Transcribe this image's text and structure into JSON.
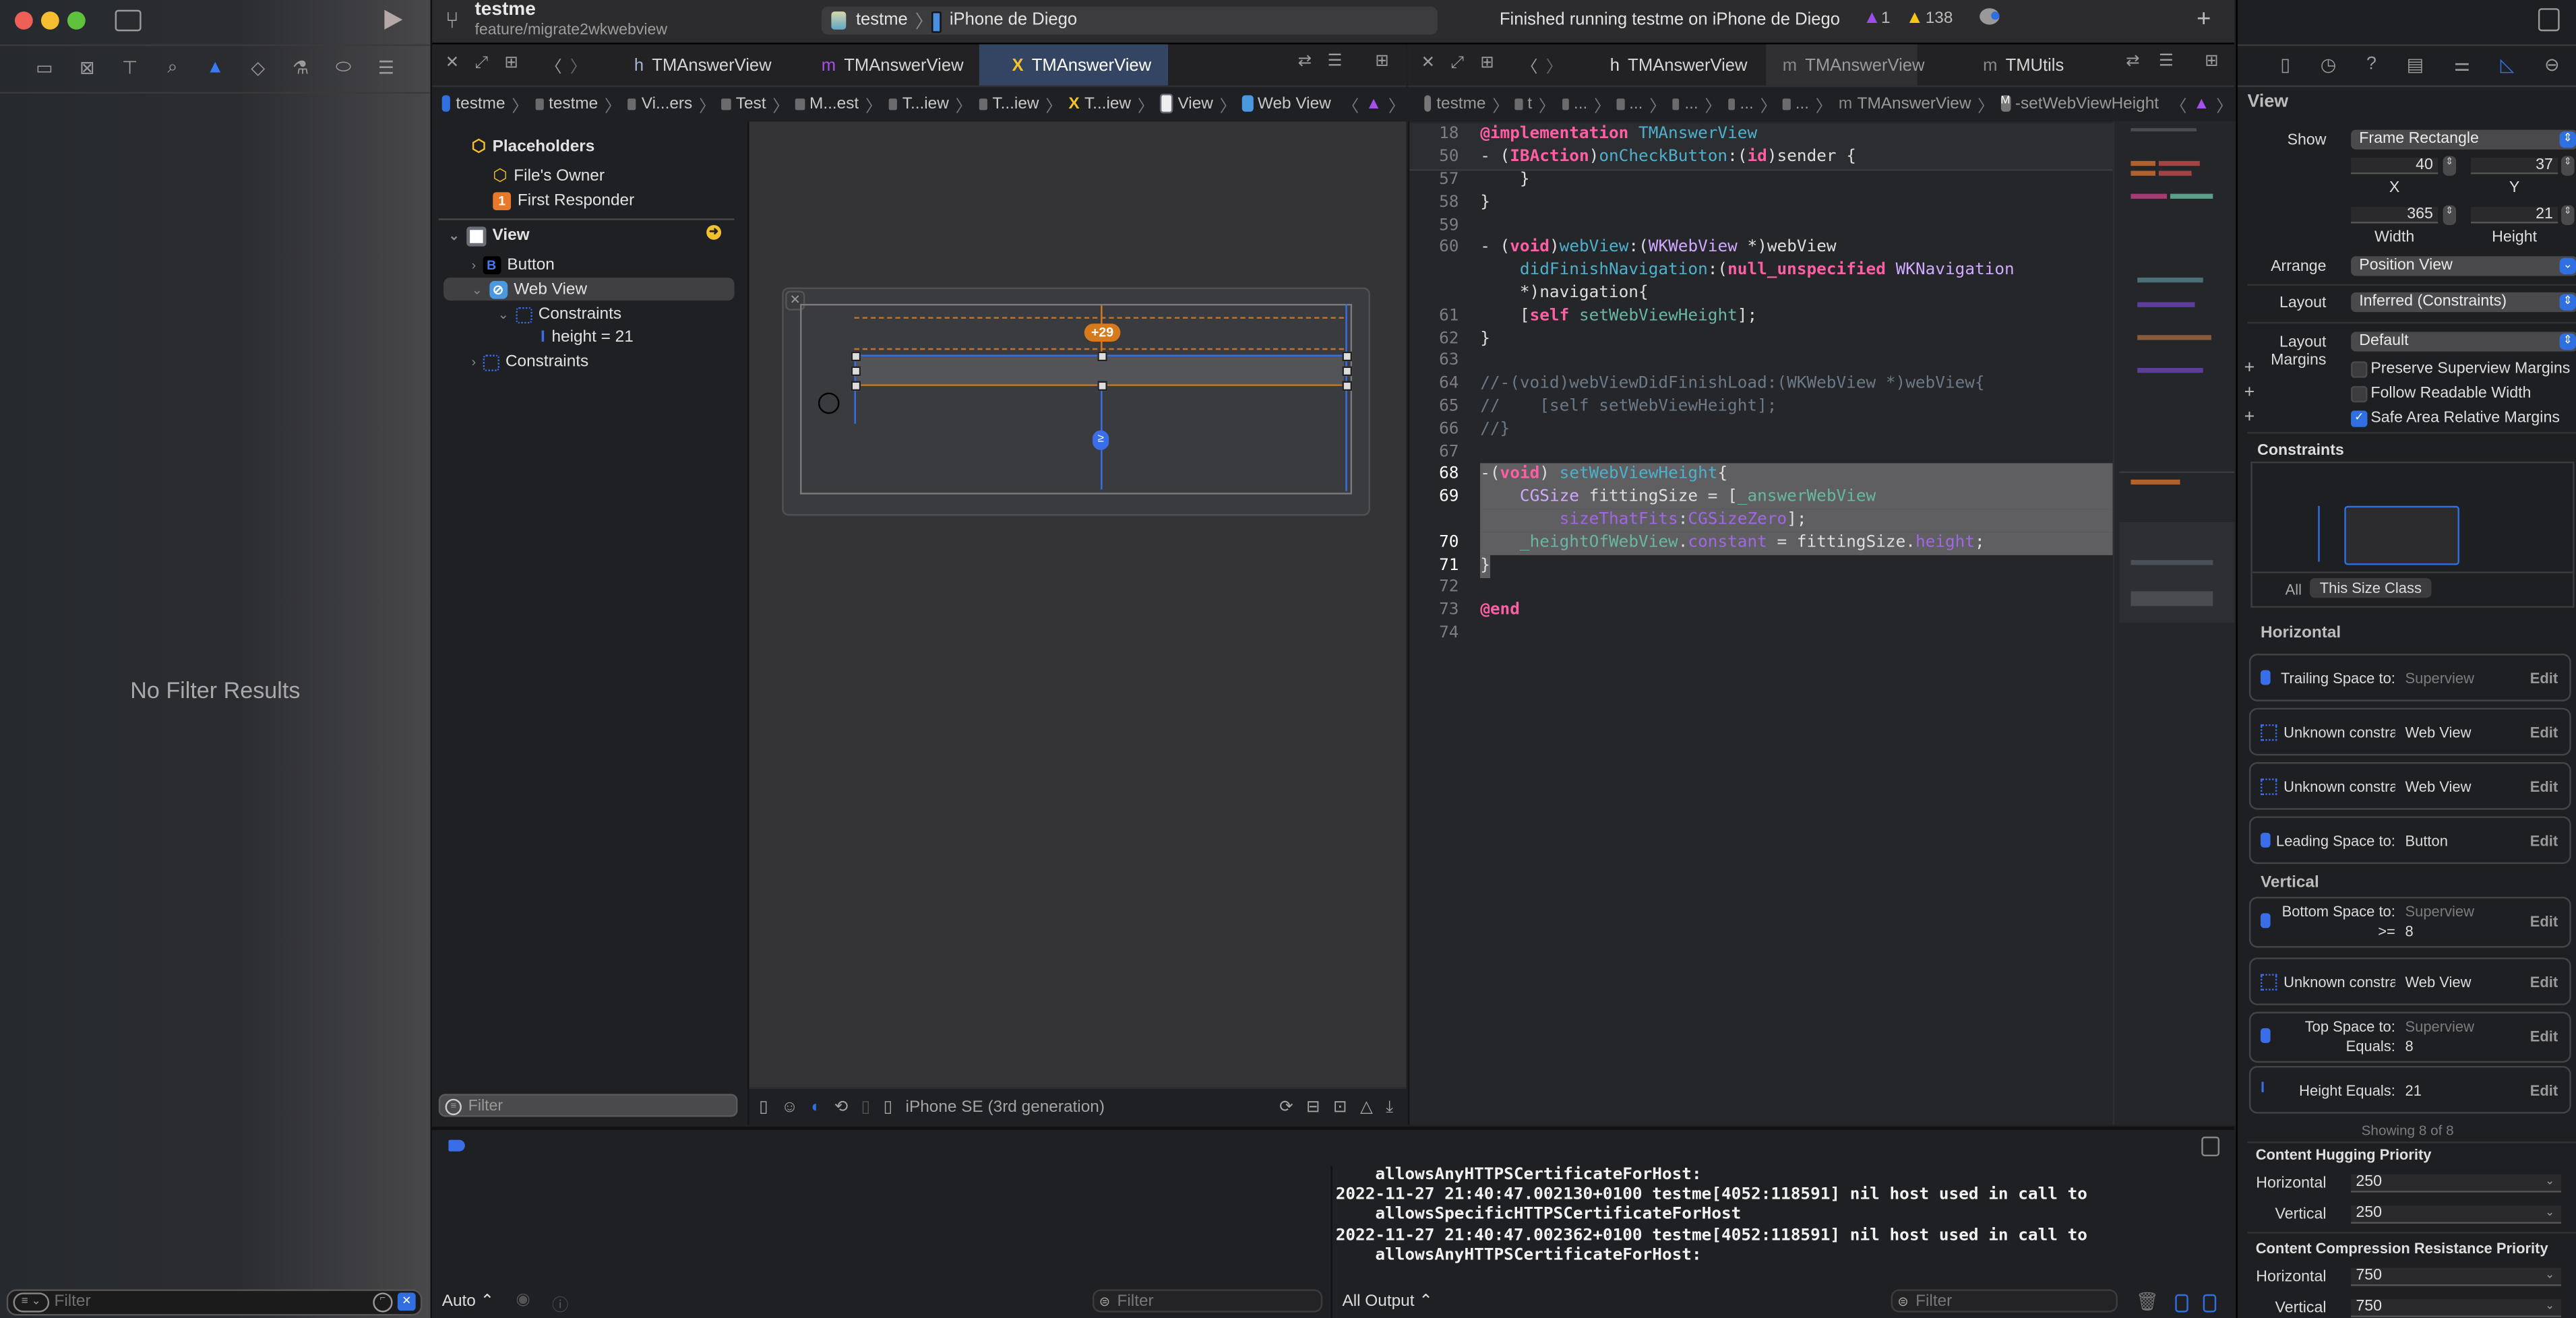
{
  "window": {
    "project": "testme",
    "branch": "feature/migrate2wkwebview",
    "scheme": "testme",
    "device": "iPhone de Diego",
    "status": "Finished running testme on iPhone de Diego",
    "runtime_issues": "1",
    "warnings": "138"
  },
  "colors": {
    "accent": "#2f6fe0",
    "active_tab": "#334563",
    "constraint_orange": "#d77a1e",
    "constraint_blue": "#2f6fe0"
  },
  "navigator": {
    "icons": [
      "folder-icon",
      "source-control-icon",
      "symbol-icon",
      "find-icon",
      "issue-icon",
      "test-icon",
      "debug-icon",
      "breakpoint-icon",
      "report-icon"
    ],
    "empty_message": "No Filter Results",
    "filter_placeholder": "Filter"
  },
  "left_editor": {
    "tabs": [
      {
        "label": "TMAnswerView",
        "icon": "h"
      },
      {
        "label": "TMAnswerView",
        "icon": "m"
      },
      {
        "label": "TMAnswerView",
        "icon": "xib",
        "active": true
      }
    ],
    "jumpbar": [
      "testme",
      "testme",
      "Vi...ers",
      "Test",
      "M...est",
      "T...iew",
      "T...iew",
      "T...iew",
      "View",
      "Web View"
    ],
    "outline": {
      "placeholders": "Placeholders",
      "files_owner": "File's Owner",
      "first_responder": "First Responder",
      "view": "View",
      "button": "Button",
      "web_view": "Web View",
      "constraints": "Constraints",
      "height_constraint": "height = 21",
      "view_constraints": "Constraints",
      "filter_placeholder": "Filter"
    },
    "canvas": {
      "top_badge": "+29",
      "bottom_badge": "≥"
    },
    "device_config": "iPhone SE (3rd generation)"
  },
  "right_editor": {
    "tabs": [
      {
        "label": "TMAnswerView",
        "icon": "h"
      },
      {
        "label": "TMAnswerView",
        "icon": "m",
        "active": true
      },
      {
        "label": "TMUtils",
        "icon": "m"
      }
    ],
    "jumpbar": [
      "testme",
      "t",
      "...",
      "...",
      "...",
      "...",
      "...",
      "TMAnswerView",
      "-setWebViewHeight"
    ],
    "code": [
      {
        "n": "18",
        "sticky": true,
        "t": [
          [
            "kw",
            "@implementation"
          ],
          [
            "pl",
            " "
          ],
          [
            "fn",
            "TMAnswerView"
          ]
        ]
      },
      {
        "n": "50",
        "sticky": true,
        "t": [
          [
            "pl",
            "- ("
          ],
          [
            "kw",
            "IBAction"
          ],
          [
            "pl",
            ")"
          ],
          [
            "fn",
            "onCheckButton"
          ],
          [
            "pl",
            ":("
          ],
          [
            "kw",
            "id"
          ],
          [
            "pl",
            ")sender {"
          ]
        ]
      },
      {
        "n": "57",
        "t": [
          [
            "pl",
            "    }"
          ]
        ]
      },
      {
        "n": "58",
        "t": [
          [
            "pl",
            "}"
          ]
        ]
      },
      {
        "n": "59",
        "t": []
      },
      {
        "n": "60",
        "t": [
          [
            "pl",
            "- ("
          ],
          [
            "kw",
            "void"
          ],
          [
            "pl",
            ")"
          ],
          [
            "fn",
            "webView"
          ],
          [
            "pl",
            ":("
          ],
          [
            "ty",
            "WKWebView"
          ],
          [
            "pl",
            " *)webView"
          ]
        ]
      },
      {
        "n": "",
        "t": [
          [
            "pl",
            "    "
          ],
          [
            "fn",
            "didFinishNavigation"
          ],
          [
            "pl",
            ":("
          ],
          [
            "kw",
            "null_unspecified"
          ],
          [
            "pl",
            " "
          ],
          [
            "ty",
            "WKNavigation"
          ]
        ]
      },
      {
        "n": "",
        "t": [
          [
            "pl",
            "    *)navigation{"
          ]
        ]
      },
      {
        "n": "61",
        "t": [
          [
            "pl",
            "    ["
          ],
          [
            "kw",
            "self"
          ],
          [
            "pl",
            " "
          ],
          [
            "ms",
            "setWebViewHeight"
          ],
          [
            "pl",
            "];"
          ]
        ]
      },
      {
        "n": "62",
        "t": [
          [
            "pl",
            "}"
          ]
        ]
      },
      {
        "n": "63",
        "t": []
      },
      {
        "n": "64",
        "t": [
          [
            "cm",
            "//-(void)webViewDidFinishLoad:(WKWebView *)webView{"
          ]
        ]
      },
      {
        "n": "65",
        "t": [
          [
            "cm",
            "//    [self setWebViewHeight];"
          ]
        ]
      },
      {
        "n": "66",
        "t": [
          [
            "cm",
            "//}"
          ]
        ]
      },
      {
        "n": "67",
        "t": []
      },
      {
        "n": "68",
        "sel": true,
        "t": [
          [
            "pl",
            "-("
          ],
          [
            "kw",
            "void"
          ],
          [
            "pl",
            ") "
          ],
          [
            "fn",
            "setWebViewHeight"
          ],
          [
            "pl",
            "{"
          ]
        ]
      },
      {
        "n": "69",
        "sel": true,
        "t": [
          [
            "pl",
            "    "
          ],
          [
            "ty",
            "CGSize"
          ],
          [
            "pl",
            " fittingSize = ["
          ],
          [
            "ms",
            "_answerWebView"
          ]
        ]
      },
      {
        "n": "",
        "sel": true,
        "t": [
          [
            "pl",
            "        "
          ],
          [
            "pr",
            "sizeThatFits"
          ],
          [
            "pl",
            ":"
          ],
          [
            "pr",
            "CGSizeZero"
          ],
          [
            "pl",
            "];"
          ]
        ]
      },
      {
        "n": "70",
        "sel": true,
        "t": [
          [
            "pl",
            "    "
          ],
          [
            "ms",
            "_heightOfWebView"
          ],
          [
            "pl",
            "."
          ],
          [
            "pr",
            "constant"
          ],
          [
            "pl",
            " = fittingSize."
          ],
          [
            "pr",
            "height"
          ],
          [
            "pl",
            ";"
          ]
        ]
      },
      {
        "n": "71",
        "selshort": true,
        "t": [
          [
            "pl",
            "}"
          ]
        ]
      },
      {
        "n": "72",
        "t": []
      },
      {
        "n": "73",
        "t": [
          [
            "kw",
            "@end"
          ]
        ]
      },
      {
        "n": "74",
        "t": []
      }
    ]
  },
  "inspector": {
    "title": "View",
    "show_label": "Show",
    "show_value": "Frame Rectangle",
    "x": "40",
    "y": "37",
    "width": "365",
    "height": "21",
    "x_label": "X",
    "y_label": "Y",
    "width_label": "Width",
    "height_label": "Height",
    "arrange_label": "Arrange",
    "arrange_value": "Position View",
    "layout_label": "Layout",
    "layout_value": "Inferred (Constraints)",
    "margins_label": "Layout Margins",
    "margins_value": "Default",
    "checks": [
      {
        "label": "Preserve Superview Margins",
        "checked": false
      },
      {
        "label": "Follow Readable Width",
        "checked": false
      },
      {
        "label": "Safe Area Relative Margins",
        "checked": true
      }
    ],
    "constraints_title": "Constraints",
    "seg_all": "All",
    "seg_size_class": "This Size Class",
    "horizontal_title": "Horizontal",
    "horizontal": [
      {
        "label": "Trailing Space to:",
        "target": "Superview",
        "target_dim": true,
        "icon": "trailing-space-icon"
      },
      {
        "label": "Unknown constraint tc",
        "target": "Web View",
        "icon": "constraint-icon"
      },
      {
        "label": "Unknown constraint tc",
        "target": "Web View",
        "icon": "constraint-icon"
      },
      {
        "label": "Leading Space to:",
        "target": "Button",
        "icon": "leading-space-icon"
      }
    ],
    "vertical_title": "Vertical",
    "vertical": [
      {
        "label": "Bottom Space to:",
        "target": "Superview",
        "target_dim": true,
        "sub_label": ">=",
        "sub_value": "8",
        "icon": "bottom-space-icon"
      },
      {
        "label": "Unknown constraint tc",
        "target": "Web View",
        "icon": "constraint-icon"
      },
      {
        "label": "Top Space to:",
        "target": "Superview",
        "target_dim": true,
        "sub_label": "Equals:",
        "sub_value": "8",
        "icon": "top-space-icon"
      },
      {
        "label": "Height Equals:",
        "target": "21",
        "icon": "height-icon"
      }
    ],
    "edit_label": "Edit",
    "showing": "Showing 8 of 8",
    "hugging_title": "Content Hugging Priority",
    "hugging_h_label": "Horizontal",
    "hugging_h": "250",
    "hugging_v_label": "Vertical",
    "hugging_v": "250",
    "compression_title": "Content Compression Resistance Priority",
    "compression_h_label": "Horizontal",
    "compression_h": "750",
    "compression_v_label": "Vertical",
    "compression_v": "750"
  },
  "debug": {
    "auto_label": "Auto ⌃",
    "vars_filter_placeholder": "Filter",
    "output_selector": "All Output ⌃",
    "console_filter_placeholder": "Filter",
    "console": [
      "    allowsAnyHTTPSCertificateForHost:",
      "2022-11-27 21:40:47.002130+0100 testme[4052:118591] nil host used in call to",
      "    allowsSpecificHTTPSCertificateForHost",
      "2022-11-27 21:40:47.002362+0100 testme[4052:118591] nil host used in call to",
      "    allowsAnyHTTPSCertificateForHost:"
    ]
  }
}
